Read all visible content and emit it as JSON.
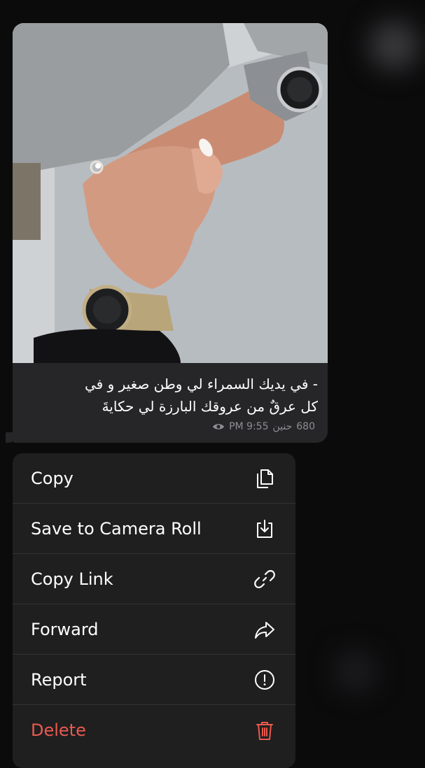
{
  "message": {
    "caption_line1": "- في يديك السمراء لي وطن صغير و في",
    "caption_line2": "كل عرقٌ من عروقك البارزة لي حكايةَ",
    "time": "PM 9:55",
    "author": "حنين",
    "views": "680"
  },
  "menu": {
    "items": [
      {
        "label": "Copy",
        "icon": "copy-icon"
      },
      {
        "label": "Save to Camera Roll",
        "icon": "save-icon"
      },
      {
        "label": "Copy Link",
        "icon": "link-icon"
      },
      {
        "label": "Forward",
        "icon": "forward-icon"
      },
      {
        "label": "Report",
        "icon": "report-icon"
      },
      {
        "label": "Delete",
        "icon": "trash-icon"
      }
    ]
  },
  "colors": {
    "background": "#0b0b0c",
    "bubble": "#262628",
    "menu": "#1f1f20",
    "danger": "#eb5a4f",
    "meta": "#8e8e93"
  }
}
